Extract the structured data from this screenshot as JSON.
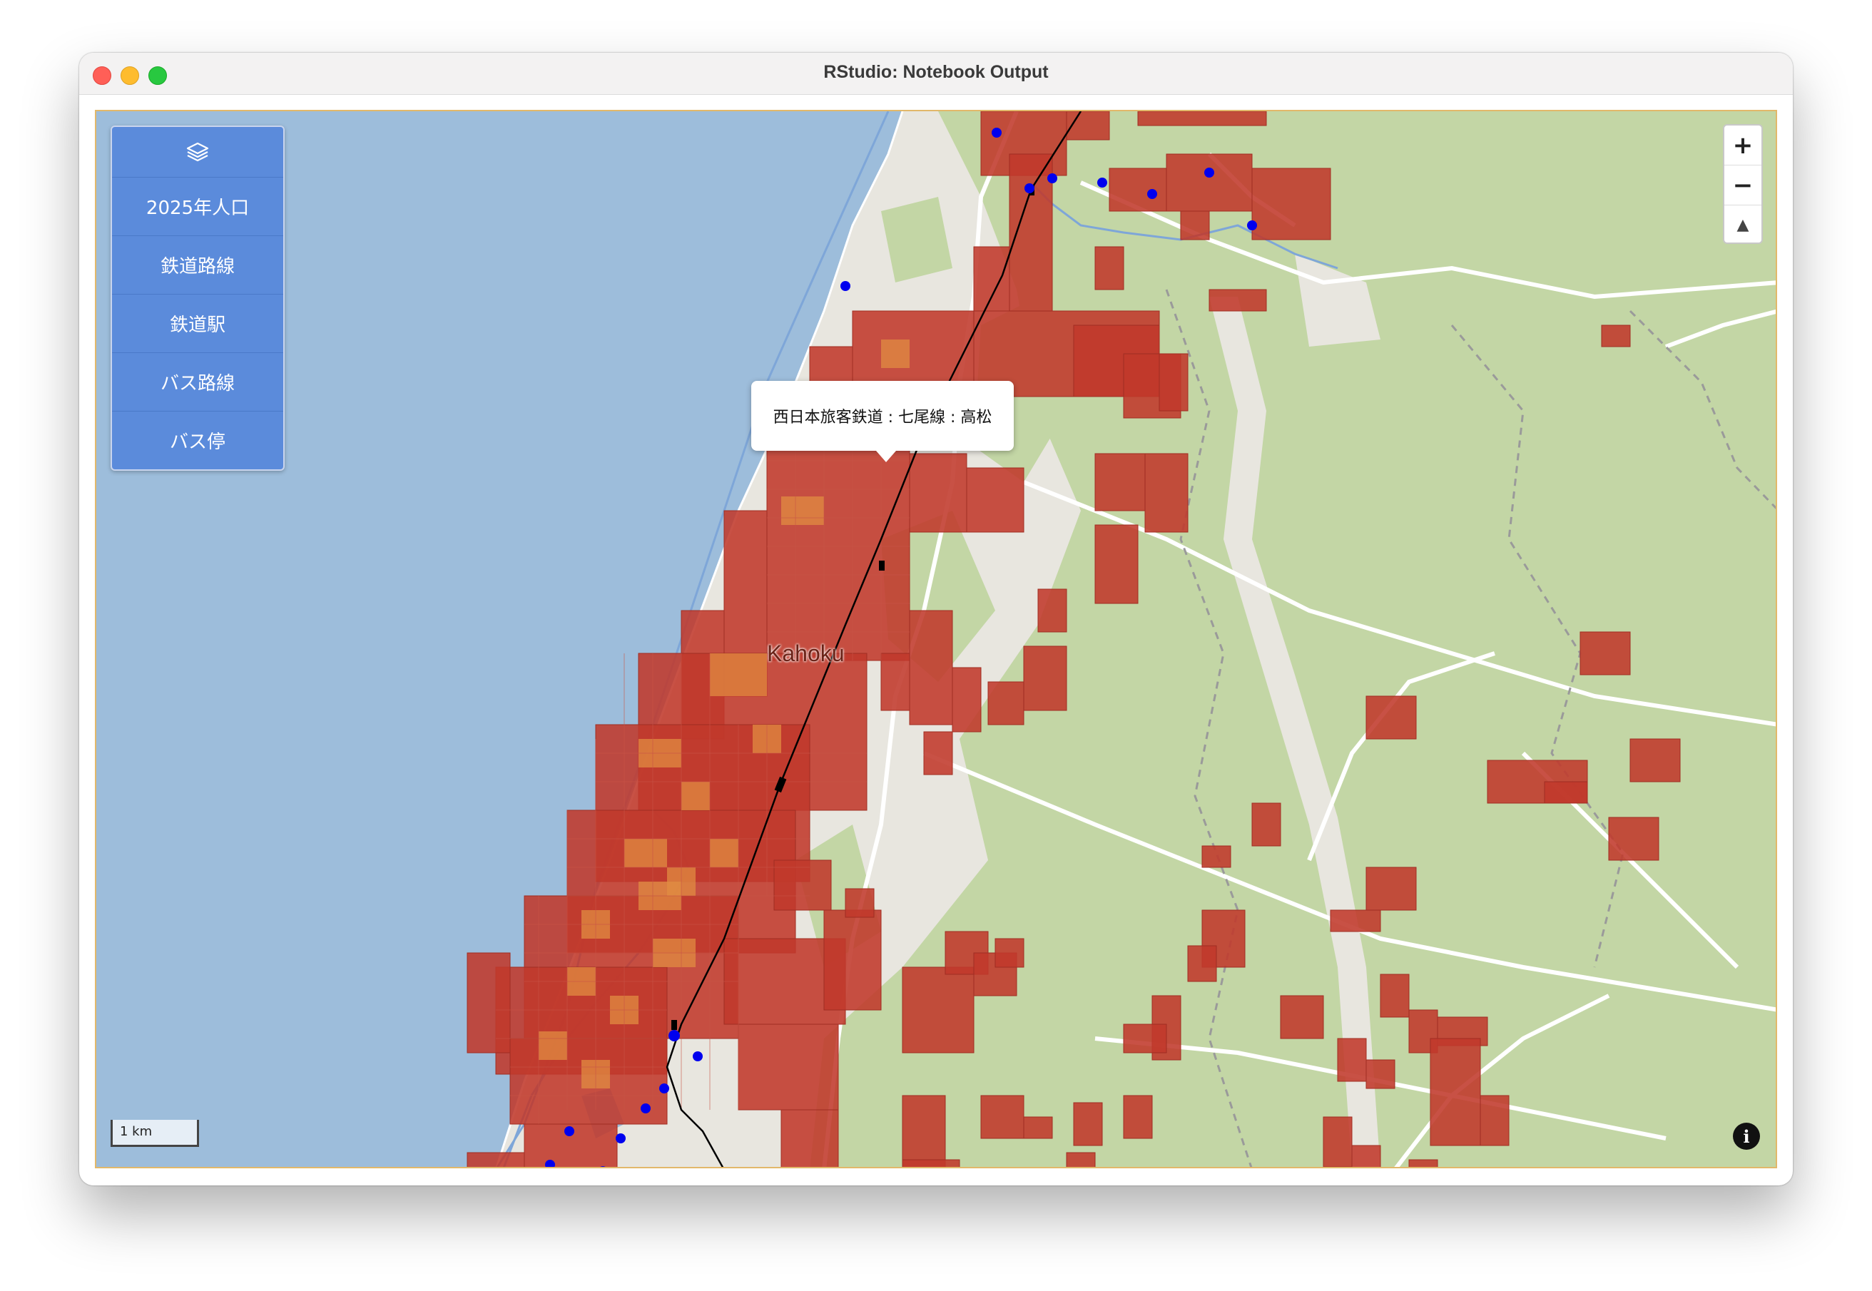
{
  "window": {
    "title": "RStudio: Notebook Output"
  },
  "layer_control": {
    "icon": "layers-icon",
    "items": [
      {
        "label": "2025年人口"
      },
      {
        "label": "鉄道路線"
      },
      {
        "label": "鉄道駅"
      },
      {
        "label": "バス路線"
      },
      {
        "label": "バス停"
      }
    ]
  },
  "map": {
    "popup": {
      "text": "西日本旅客鉄道 : 七尾線 : 高松"
    },
    "place_label": "Kahoku",
    "scale_label": "1 km",
    "zoom_in_label": "+",
    "zoom_out_label": "−",
    "compass_label": "▲",
    "info_label": "i",
    "colors": {
      "sea": "#9dbddb",
      "land": "#e8e6df",
      "forest": "#c3d6a5",
      "population_cell": "#c0392b",
      "population_cell_high": "#e08c42",
      "rail": "#000000",
      "bus_stop": "#0000ff",
      "bus_route": "#7ea6d8"
    }
  }
}
